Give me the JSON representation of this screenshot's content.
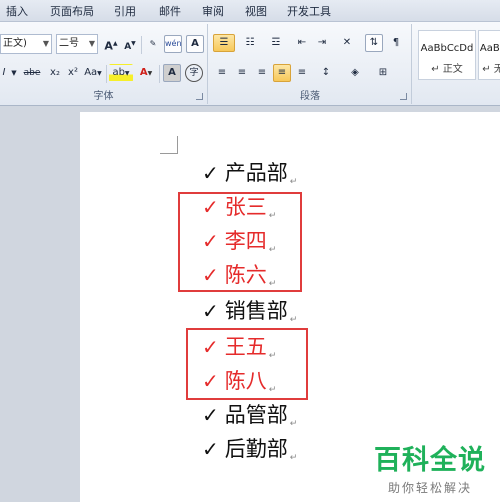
{
  "menu": {
    "tabs": [
      "插入",
      "页面布局",
      "引用",
      "邮件",
      "审阅",
      "视图",
      "开发工具"
    ]
  },
  "ribbon": {
    "font_group": {
      "label": "字体",
      "font_name": "正文)",
      "font_size": "二号",
      "buttons": {
        "grow": "A",
        "shrink": "A",
        "phonetic": "wén",
        "border_char": "A",
        "strike": "abe",
        "subscript": "x₂",
        "superscript": "x²",
        "case": "Aa",
        "highlight": "ab",
        "font_color": "A",
        "char_shading": "A",
        "enclose": "字"
      }
    },
    "paragraph_group": {
      "label": "段落"
    },
    "styles_group": {
      "items": [
        {
          "sample": "AaBbCcDd",
          "name": "↵ 正文"
        },
        {
          "sample": "AaBb",
          "name": "↵ 无"
        }
      ]
    }
  },
  "document": {
    "lines": [
      {
        "check": "✓",
        "text": "产品部",
        "mark": "↵",
        "color": "#111111"
      },
      {
        "check": "✓",
        "text": "张三",
        "mark": "↵",
        "color": "#e52b2b"
      },
      {
        "check": "✓",
        "text": "李四",
        "mark": "↵",
        "color": "#e52b2b"
      },
      {
        "check": "✓",
        "text": "陈六",
        "mark": "↵",
        "color": "#e52b2b"
      },
      {
        "check": "✓",
        "text": "销售部",
        "mark": "↵",
        "color": "#111111"
      },
      {
        "check": "✓",
        "text": "王五",
        "mark": "↵",
        "color": "#e52b2b"
      },
      {
        "check": "✓",
        "text": "陈八",
        "mark": "↵",
        "color": "#e52b2b"
      },
      {
        "check": "✓",
        "text": "品管部",
        "mark": "↵",
        "color": "#111111"
      },
      {
        "check": "✓",
        "text": "后勤部",
        "mark": "↵",
        "color": "#111111"
      }
    ],
    "highlight_color": "#e03c3c"
  },
  "watermark": {
    "title": "百科全说",
    "subtitle": "助你轻松解决"
  },
  "colors": {
    "red_text": "#e52b2b",
    "watermark_green": "#1fb15a"
  }
}
